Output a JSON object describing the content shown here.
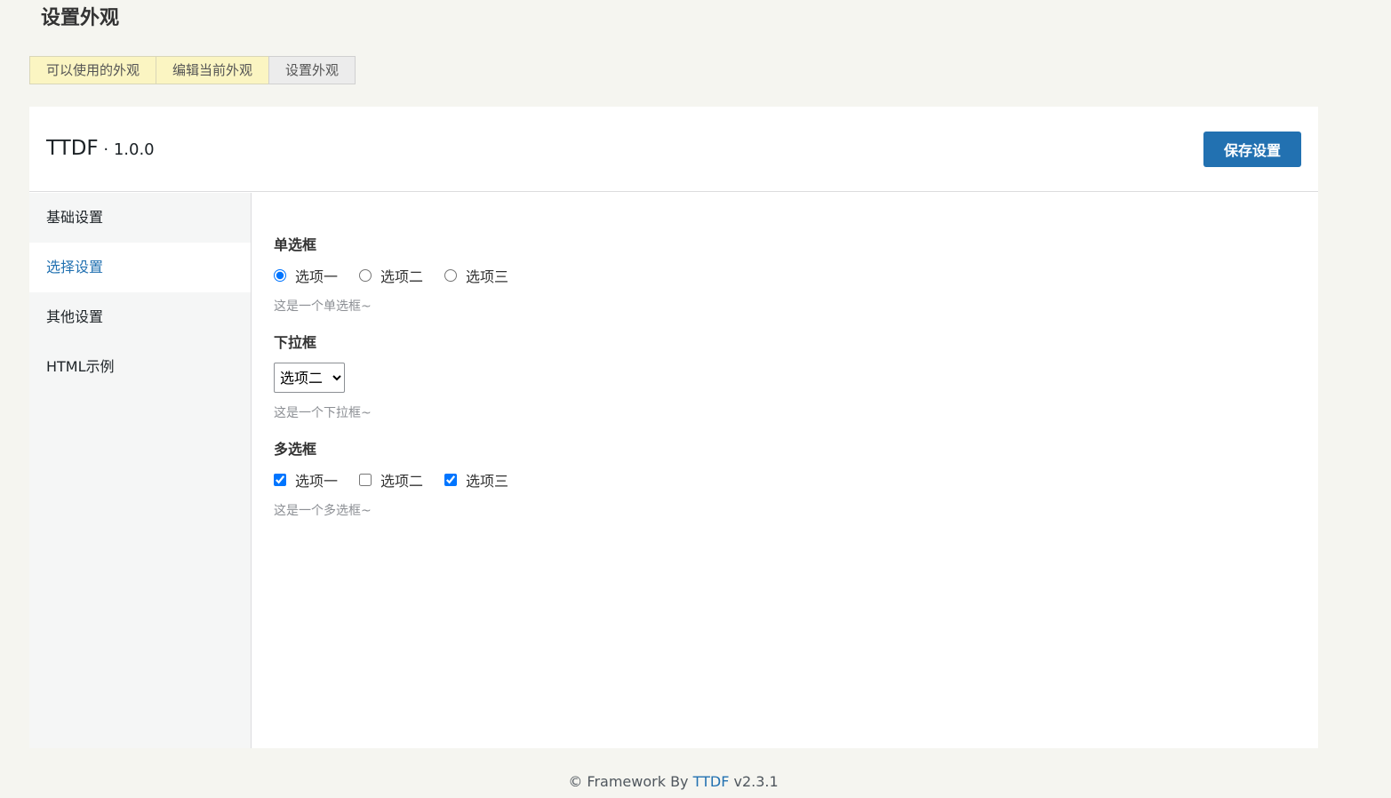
{
  "page": {
    "title": "设置外观"
  },
  "tabs": [
    {
      "label": "可以使用的外观"
    },
    {
      "label": "编辑当前外观"
    },
    {
      "label": "设置外观"
    }
  ],
  "header": {
    "brand": "TTDF",
    "sep": " · ",
    "version": "1.0.0",
    "save_label": "保存设置"
  },
  "sidebar": {
    "items": [
      {
        "label": "基础设置"
      },
      {
        "label": "选择设置"
      },
      {
        "label": "其他设置"
      },
      {
        "label": "HTML示例"
      }
    ],
    "active_index": 1
  },
  "fields": {
    "radio": {
      "title": "单选框",
      "options": [
        "选项一",
        "选项二",
        "选项三"
      ],
      "selected": "选项一",
      "desc": "这是一个单选框~"
    },
    "select": {
      "title": "下拉框",
      "value": "选项二",
      "desc": "这是一个下拉框~"
    },
    "checkbox": {
      "title": "多选框",
      "options": [
        "选项一",
        "选项二",
        "选项三"
      ],
      "checked": [
        "选项一",
        "选项三"
      ],
      "desc": "这是一个多选框~"
    }
  },
  "footer": {
    "prefix": "© Framework By ",
    "link": "TTDF",
    "version": " v2.3.1"
  },
  "colors": {
    "accent": "#2271b1",
    "tab_bg": "#fbf5c2",
    "active_tab_bg": "#ececec"
  }
}
